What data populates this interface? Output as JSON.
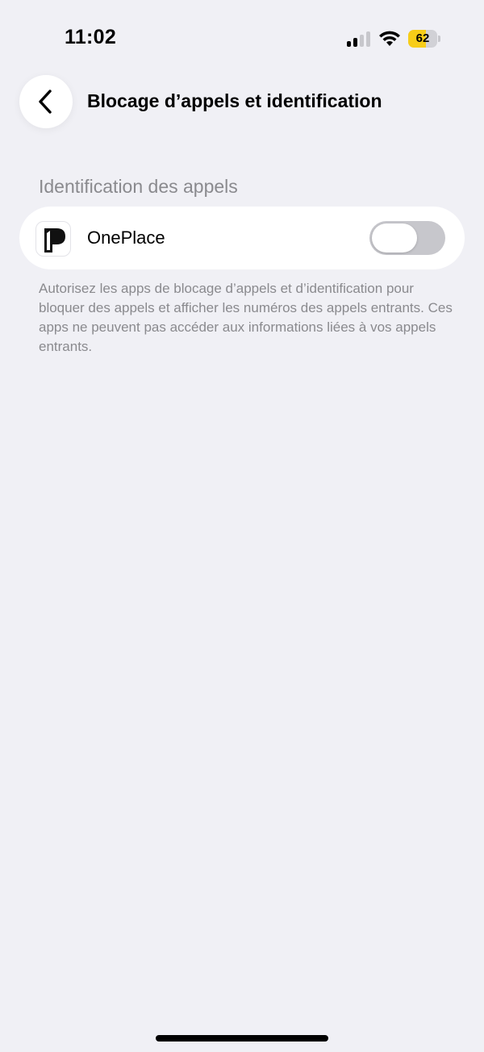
{
  "status_bar": {
    "time": "11:02",
    "battery_level": "62",
    "battery_fraction": 0.62,
    "signal_bars_active": 2,
    "signal_bars_total": 4
  },
  "nav": {
    "title": "Blocage d’appels et identification",
    "back_icon": "chevron-left-icon"
  },
  "section": {
    "header": "Identification des appels",
    "items": [
      {
        "app_name": "OnePlace",
        "icon": "oneplace-app-icon",
        "enabled": false
      }
    ],
    "footer": "Autorisez les apps de blocage d’appels et d’identification pour bloquer des appels et afficher les numéros des appels entrants. Ces apps ne peuvent pas accéder aux informations liées à vos appels entrants."
  },
  "colors": {
    "background": "#f0f0f5",
    "card": "#ffffff",
    "toggle_off": "#c7c7cc",
    "battery_yellow": "#f7cd18",
    "secondary_text": "#8a8a8e"
  }
}
